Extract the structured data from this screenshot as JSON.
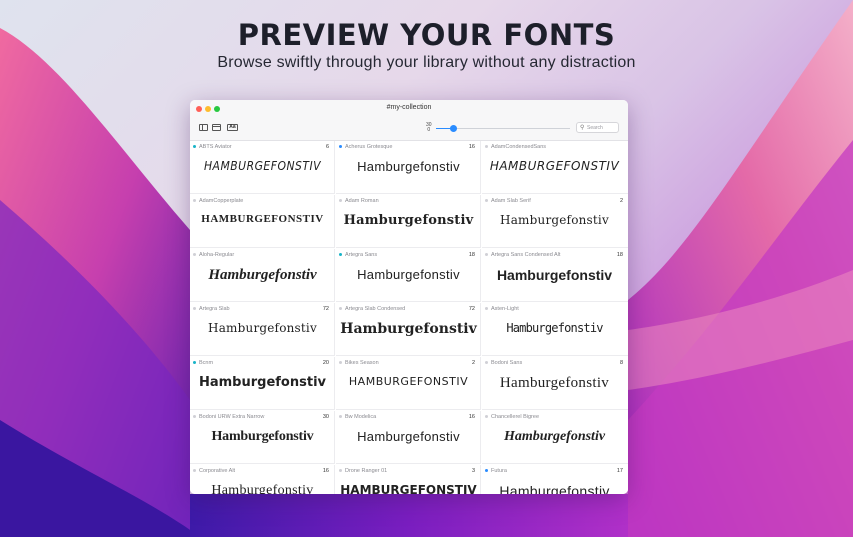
{
  "hero": {
    "title": "PREVIEW YOUR FONTS",
    "subtitle": "Browse swiftly through your library without any distraction"
  },
  "colors": {
    "accent": "#2a8cff",
    "close": "#ff5f57",
    "minimize": "#febc2e",
    "zoom": "#28c840",
    "dot_teal": "#18b4c8",
    "dot_blue": "#2a8cff",
    "dot_empty": "#d0d0d6"
  },
  "window": {
    "title": "#my-collection",
    "toolbar": {
      "sidebar_icon": "sidebar-icon",
      "window_icon": "window-icon",
      "aa_label": "Aa",
      "size_value": "30",
      "size_min": "0",
      "slider_fraction": 0.13,
      "search_placeholder": "Search"
    }
  },
  "fonts": [
    {
      "name": "ABTS Aviator",
      "count": "6",
      "sample": "HAMBURGEFONSTIV",
      "dot": "teal"
    },
    {
      "name": "Acherus Grotesque",
      "count": "16",
      "sample": "Hamburgefonstiv",
      "dot": "blue"
    },
    {
      "name": "AdamCondensedSans",
      "count": "",
      "sample": "HAMBURGEFONSTIV",
      "dot": "empty"
    },
    {
      "name": "AdamCopperplate",
      "count": "",
      "sample": "HAMBURGEFONSTIV",
      "dot": "empty"
    },
    {
      "name": "Adam Roman",
      "count": "",
      "sample": "Hamburgefonstiv",
      "dot": "empty"
    },
    {
      "name": "Adam Slab Serif",
      "count": "2",
      "sample": "Hamburgefonstiv",
      "dot": "empty"
    },
    {
      "name": "Aloha-Regular",
      "count": "",
      "sample": "Hamburgefonstiv",
      "dot": "empty"
    },
    {
      "name": "Artegra Sans",
      "count": "18",
      "sample": "Hamburgefonstiv",
      "dot": "teal"
    },
    {
      "name": "Artegra Sans Condensed Alt",
      "count": "18",
      "sample": "Hamburgefonstiv",
      "dot": "empty"
    },
    {
      "name": "Artegra Slab",
      "count": "72",
      "sample": "Hamburgefonstiv",
      "dot": "empty"
    },
    {
      "name": "Artegra Slab Condensed",
      "count": "72",
      "sample": "Hamburgefonstiv",
      "dot": "empty"
    },
    {
      "name": "Asten-Light",
      "count": "",
      "sample": "Hamburgefonstiv",
      "dot": "empty"
    },
    {
      "name": "Bcnm",
      "count": "20",
      "sample": "Hamburgefonstiv",
      "dot": "teal"
    },
    {
      "name": "Bikes Season",
      "count": "2",
      "sample": "HAMBURGEFONSTIV",
      "dot": "empty"
    },
    {
      "name": "Bodoni Sans",
      "count": "8",
      "sample": "Hamburgefonstiv",
      "dot": "empty"
    },
    {
      "name": "Bodoni URW Extra Narrow",
      "count": "30",
      "sample": "Hamburgefonstiv",
      "dot": "empty"
    },
    {
      "name": "Bw Modelica",
      "count": "16",
      "sample": "Hamburgefonstiv",
      "dot": "empty"
    },
    {
      "name": "Chancellerel Bigree",
      "count": "",
      "sample": "Hamburgefonstiv",
      "dot": "empty"
    },
    {
      "name": "Corporative Alt",
      "count": "16",
      "sample": "Hamburgefonstiv",
      "dot": "empty"
    },
    {
      "name": "Drone Ranger 01",
      "count": "3",
      "sample": "HAMBURGEFONSTIV",
      "dot": "empty"
    },
    {
      "name": "Futura",
      "count": "17",
      "sample": "Hamburgefonstiv",
      "dot": "blue"
    }
  ]
}
